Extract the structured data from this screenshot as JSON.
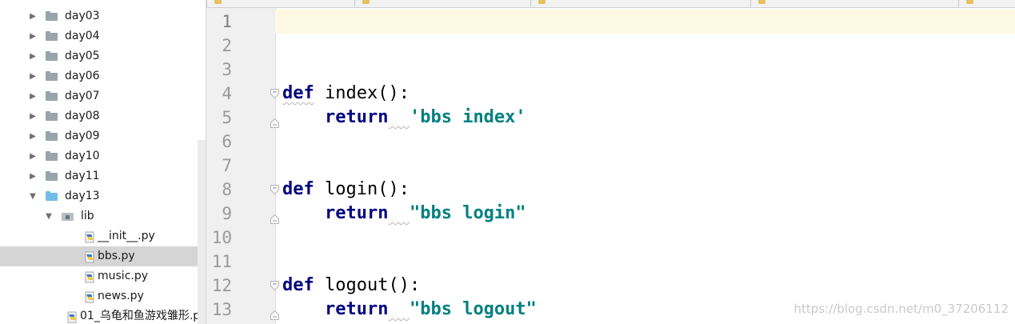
{
  "project_tree": {
    "items": [
      {
        "label": "day03",
        "kind": "folder",
        "level": 1,
        "state": "collapsed"
      },
      {
        "label": "day04",
        "kind": "folder",
        "level": 1,
        "state": "collapsed"
      },
      {
        "label": "day05",
        "kind": "folder",
        "level": 1,
        "state": "collapsed"
      },
      {
        "label": "day06",
        "kind": "folder",
        "level": 1,
        "state": "collapsed"
      },
      {
        "label": "day07",
        "kind": "folder",
        "level": 1,
        "state": "collapsed"
      },
      {
        "label": "day08",
        "kind": "folder",
        "level": 1,
        "state": "collapsed"
      },
      {
        "label": "day09",
        "kind": "folder",
        "level": 1,
        "state": "collapsed"
      },
      {
        "label": "day10",
        "kind": "folder",
        "level": 1,
        "state": "collapsed"
      },
      {
        "label": "day11",
        "kind": "folder",
        "level": 1,
        "state": "collapsed"
      },
      {
        "label": "day13",
        "kind": "folder-open",
        "level": 1,
        "state": "expanded"
      },
      {
        "label": "lib",
        "kind": "package",
        "level": 2,
        "state": "expanded"
      },
      {
        "label": "__init__.py",
        "kind": "python-file",
        "level": 3
      },
      {
        "label": "bbs.py",
        "kind": "python-file",
        "level": 3,
        "selected": true
      },
      {
        "label": "music.py",
        "kind": "python-file",
        "level": 3
      },
      {
        "label": "news.py",
        "kind": "python-file",
        "level": 3
      },
      {
        "label": "01_乌龟和鱼游戏雏形.p",
        "kind": "python-file",
        "level": 2
      }
    ]
  },
  "editor": {
    "file": "bbs.py",
    "current_line": 1,
    "lines": [
      {
        "num": "1",
        "tokens": []
      },
      {
        "num": "2",
        "tokens": []
      },
      {
        "num": "3",
        "tokens": []
      },
      {
        "num": "4",
        "fold": "start",
        "tokens": [
          {
            "t": "def",
            "c": "kw",
            "wavy": true
          },
          {
            "t": " index():",
            "c": "plain"
          }
        ]
      },
      {
        "num": "5",
        "fold": "end",
        "tokens": [
          {
            "t": "    "
          },
          {
            "t": "return",
            "c": "kw"
          },
          {
            "t": "  ",
            "c": "plain",
            "wavy": true
          },
          {
            "t": "'bbs index'",
            "c": "str"
          }
        ]
      },
      {
        "num": "6",
        "tokens": []
      },
      {
        "num": "7",
        "tokens": []
      },
      {
        "num": "8",
        "fold": "start",
        "tokens": [
          {
            "t": "def",
            "c": "kw"
          },
          {
            "t": " login():",
            "c": "plain"
          }
        ]
      },
      {
        "num": "9",
        "fold": "end",
        "tokens": [
          {
            "t": "    "
          },
          {
            "t": "return",
            "c": "kw"
          },
          {
            "t": "  ",
            "c": "plain",
            "wavy": true
          },
          {
            "t": "\"bbs login\"",
            "c": "str"
          }
        ]
      },
      {
        "num": "10",
        "tokens": []
      },
      {
        "num": "11",
        "tokens": []
      },
      {
        "num": "12",
        "fold": "start",
        "tokens": [
          {
            "t": "def",
            "c": "kw"
          },
          {
            "t": " logout():",
            "c": "plain"
          }
        ]
      },
      {
        "num": "13",
        "fold": "end",
        "tokens": [
          {
            "t": "    "
          },
          {
            "t": "return",
            "c": "kw"
          },
          {
            "t": "  ",
            "c": "plain",
            "wavy": true
          },
          {
            "t": "\"bbs logout\"",
            "c": "str"
          }
        ]
      }
    ]
  },
  "watermark": "https://blog.csdn.net/m0_37206112",
  "colors": {
    "keyword": "#000080",
    "string": "#008080",
    "caret_line": "#fdf9e3",
    "gutter": "#f0f0f0",
    "selection": "#d5d5d5"
  }
}
